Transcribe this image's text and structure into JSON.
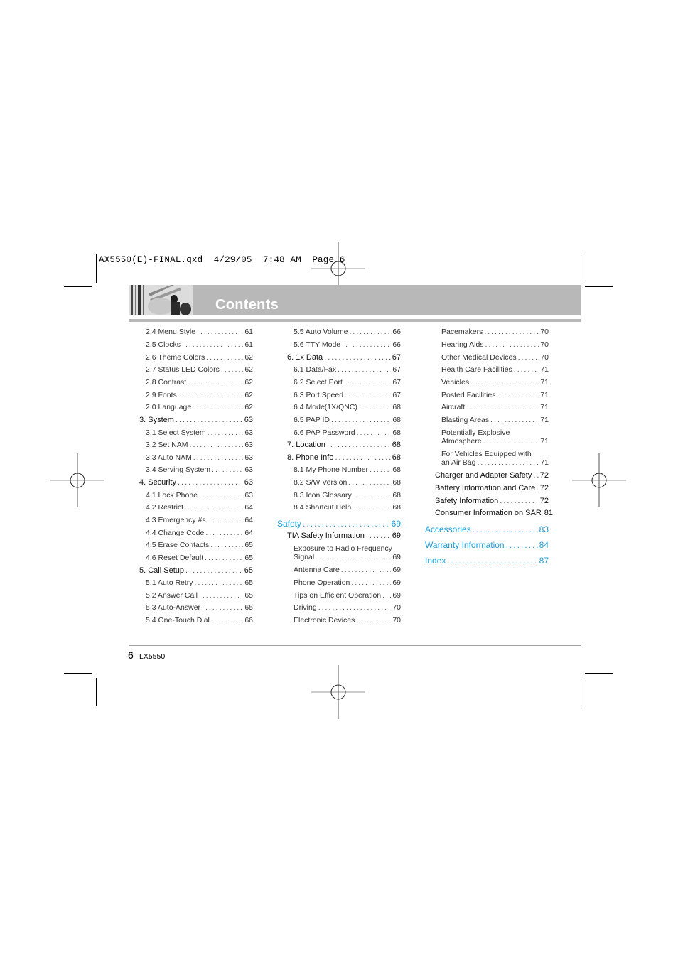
{
  "print_slug": "AX5550(E)-FINAL.qxd  4/29/05  7:48 AM  Page 6",
  "header": {
    "title": "Contents",
    "photo": "header-photo"
  },
  "footer": {
    "page_number": "6",
    "model": "LX5550"
  },
  "colors": {
    "accent": "#1a9ed9",
    "header_bar": "#b8b8b8",
    "text": "#333333"
  },
  "toc": {
    "col1": [
      {
        "label": "2.4 Menu Style",
        "page": "61",
        "level": 2
      },
      {
        "label": "2.5 Clocks",
        "page": "61",
        "level": 2
      },
      {
        "label": "2.6 Theme Colors",
        "page": "62",
        "level": 2
      },
      {
        "label": "2.7 Status LED Colors",
        "page": "62",
        "level": 2
      },
      {
        "label": "2.8 Contrast",
        "page": "62",
        "level": 2
      },
      {
        "label": "2.9 Fonts",
        "page": "62",
        "level": 2
      },
      {
        "label": "2.0 Language",
        "page": "62",
        "level": 2
      },
      {
        "label": "3. System",
        "page": "63",
        "level": 1
      },
      {
        "label": "3.1 Select System",
        "page": "63",
        "level": 2
      },
      {
        "label": "3.2 Set NAM",
        "page": "63",
        "level": 2
      },
      {
        "label": "3.3 Auto NAM",
        "page": "63",
        "level": 2
      },
      {
        "label": "3.4 Serving System",
        "page": "63",
        "level": 2
      },
      {
        "label": "4. Security",
        "page": "63",
        "level": 1
      },
      {
        "label": "4.1 Lock Phone",
        "page": "63",
        "level": 2
      },
      {
        "label": "4.2 Restrict",
        "page": "64",
        "level": 2
      },
      {
        "label": "4.3 Emergency #s",
        "page": "64",
        "level": 2
      },
      {
        "label": "4.4 Change Code",
        "page": "64",
        "level": 2
      },
      {
        "label": "4.5 Erase Contacts",
        "page": "65",
        "level": 2
      },
      {
        "label": "4.6 Reset Default",
        "page": "65",
        "level": 2
      },
      {
        "label": "5. Call Setup",
        "page": "65",
        "level": 1
      },
      {
        "label": "5.1 Auto Retry",
        "page": "65",
        "level": 2
      },
      {
        "label": "5.2 Answer Call",
        "page": "65",
        "level": 2
      },
      {
        "label": "5.3 Auto-Answer",
        "page": "65",
        "level": 2
      },
      {
        "label": "5.4 One-Touch Dial",
        "page": "66",
        "level": 2
      }
    ],
    "col2": [
      {
        "label": "5.5 Auto Volume",
        "page": "66",
        "level": 2
      },
      {
        "label": "5.6 TTY Mode",
        "page": "66",
        "level": 2
      },
      {
        "label": "6. 1x Data",
        "page": "67",
        "level": 1
      },
      {
        "label": "6.1 Data/Fax",
        "page": "67",
        "level": 2
      },
      {
        "label": "6.2 Select Port",
        "page": "67",
        "level": 2
      },
      {
        "label": "6.3 Port Speed",
        "page": "67",
        "level": 2
      },
      {
        "label": "6.4 Mode(1X/QNC)",
        "page": "68",
        "level": 2
      },
      {
        "label": "6.5 PAP ID",
        "page": "68",
        "level": 2
      },
      {
        "label": "6.6 PAP Password",
        "page": "68",
        "level": 2
      },
      {
        "label": "7. Location",
        "page": "68",
        "level": 1
      },
      {
        "label": "8. Phone Info",
        "page": "68",
        "level": 1
      },
      {
        "label": "8.1 My Phone Number",
        "page": "68",
        "level": 2
      },
      {
        "label": "8.2 S/W Version",
        "page": "68",
        "level": 2
      },
      {
        "label": "8.3 Icon Glossary",
        "page": "68",
        "level": 2
      },
      {
        "label": "8.4 Shortcut Help",
        "page": "68",
        "level": 2
      },
      {
        "label": "Safety",
        "page": "69",
        "level": 0
      },
      {
        "label": "TIA Safety Information",
        "page": "69",
        "level": 1
      },
      {
        "label": "Exposure to Radio Frequency",
        "label2": "Signal",
        "page": "69",
        "level": 2
      },
      {
        "label": "Antenna Care",
        "page": "69",
        "level": 2
      },
      {
        "label": "Phone Operation",
        "page": "69",
        "level": 2
      },
      {
        "label": "Tips on Efficient Operation",
        "page": "69",
        "level": 2
      },
      {
        "label": "Driving",
        "page": "70",
        "level": 2
      },
      {
        "label": "Electronic Devices",
        "page": "70",
        "level": 2
      }
    ],
    "col3": [
      {
        "label": "Pacemakers",
        "page": "70",
        "level": 2
      },
      {
        "label": "Hearing Aids",
        "page": "70",
        "level": 2
      },
      {
        "label": "Other Medical Devices",
        "page": "70",
        "level": 2
      },
      {
        "label": "Health Care Facilities",
        "page": "71",
        "level": 2
      },
      {
        "label": "Vehicles",
        "page": "71",
        "level": 2
      },
      {
        "label": "Posted Facilities",
        "page": "71",
        "level": 2
      },
      {
        "label": "Aircraft",
        "page": "71",
        "level": 2
      },
      {
        "label": "Blasting Areas",
        "page": "71",
        "level": 2
      },
      {
        "label": "Potentially Explosive",
        "label2": "Atmosphere",
        "page": "71",
        "level": 2
      },
      {
        "label": "For Vehicles Equipped with",
        "label2": "an Air Bag",
        "page": "71",
        "level": 2
      },
      {
        "label": "Charger and Adapter Safety",
        "page": "72",
        "level": 1
      },
      {
        "label": "Battery Information and Care",
        "page": "72",
        "level": 1
      },
      {
        "label": "Safety Information",
        "page": "72",
        "level": 1
      },
      {
        "label": "Consumer Information on SAR",
        "page": "81",
        "level": 1
      },
      {
        "label": "Accessories",
        "page": "83",
        "level": 0
      },
      {
        "label": "Warranty Information",
        "page": "84",
        "level": 0
      },
      {
        "label": "Index",
        "page": "87",
        "level": 0
      }
    ]
  }
}
